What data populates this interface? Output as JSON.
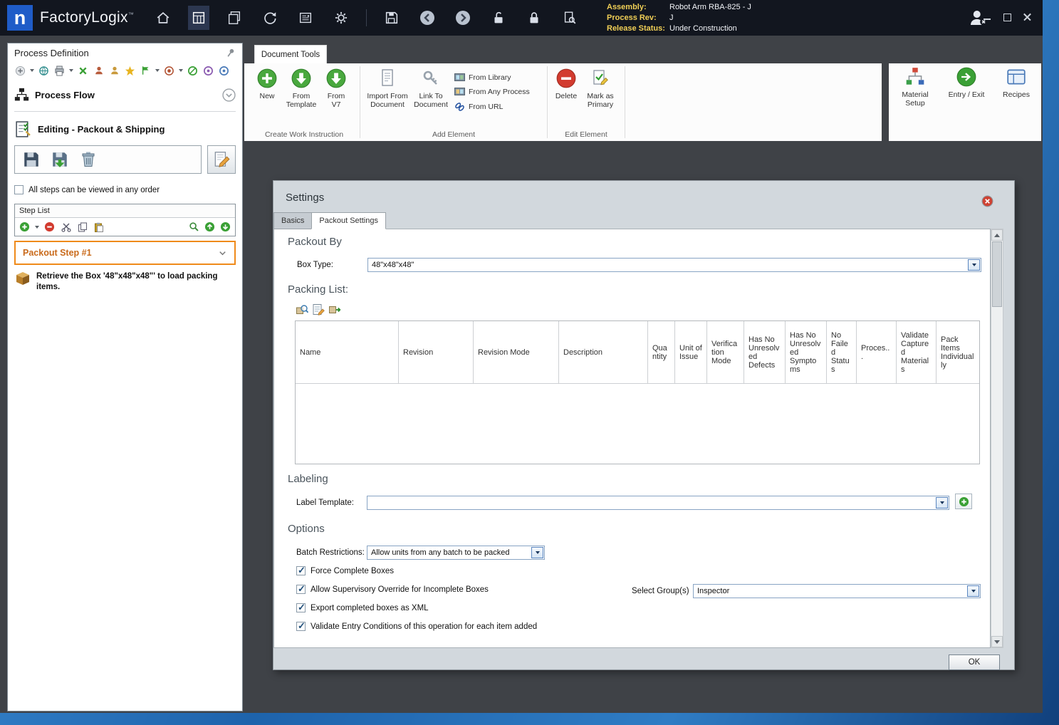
{
  "colors": {
    "titlebar_bg": "#12161F",
    "logo_blue": "#1F5CC8",
    "workspace_bg": "#3F4247",
    "dialog_bg": "#D2D8DD",
    "accent_orange": "#EF8A1A",
    "selected_step_text": "#C96A1B",
    "info_label_yellow": "#F0CF56"
  },
  "titlebar": {
    "logo_letter": "n",
    "app_name": "FactoryLogix",
    "trademark": "™",
    "info": {
      "assembly_label": "Assembly:",
      "assembly_value": "Robot Arm RBA-825 - J",
      "process_rev_label": "Process Rev:",
      "process_rev_value": "J",
      "release_status_label": "Release Status:",
      "release_status_value": "Under Construction"
    }
  },
  "left_panel": {
    "title": "Process Definition",
    "process_flow_label": "Process Flow",
    "editing_header": "Editing - Packout & Shipping",
    "order_checkbox_label": "All steps can be viewed in any order",
    "order_checkbox_checked": false,
    "step_list_title": "Step List",
    "selected_step_title": "Packout Step #1",
    "step_instruction": "Retrieve the Box '48\"x48\"x48\"' to load packing items."
  },
  "ribbon": {
    "tab_label": "Document Tools",
    "group_create": "Create Work Instruction",
    "group_add": "Add Element",
    "group_edit": "Edit Element",
    "new_label": "New",
    "from_template_label": "From Template",
    "from_v7_label": "From V7",
    "import_from_document_label": "Import From Document",
    "link_to_document_label": "Link To Document",
    "from_library_label": "From Library",
    "from_any_process_label": "From Any Process",
    "from_url_label": "From URL",
    "delete_label": "Delete",
    "mark_as_primary_label": "Mark as Primary",
    "material_setup_label": "Material Setup",
    "entry_exit_label": "Entry / Exit",
    "recipes_label": "Recipes"
  },
  "dialog": {
    "title": "Settings",
    "tab_basics": "Basics",
    "tab_packout": "Packout Settings",
    "heading_packout_by": "Packout By",
    "heading_packing_list": "Packing List:",
    "heading_labeling": "Labeling",
    "heading_options": "Options",
    "box_type_label": "Box Type:",
    "box_type_value": "48\"x48\"x48\"",
    "label_template_label": "Label Template:",
    "label_template_value": "",
    "batch_restrictions_label": "Batch Restrictions:",
    "batch_restrictions_value": "Allow units from any batch to be packed",
    "select_groups_label": "Select Group(s)",
    "select_groups_value": "Inspector",
    "ok_label": "OK",
    "grid_columns": [
      "Name",
      "Revision",
      "Revision Mode",
      "Description",
      "Quantity",
      "Unit of Issue",
      "Verification Mode",
      "Has No Unresolved Defects",
      "Has No Unresolved Symptoms",
      "No Failed Status",
      "Proces...",
      "Validate Captured Materials",
      "Pack Items Individually"
    ],
    "checkboxes": [
      {
        "label": "Force Complete Boxes",
        "checked": true
      },
      {
        "label": "Allow Supervisory Override for Incomplete Boxes",
        "checked": true
      },
      {
        "label": "Export completed boxes as XML",
        "checked": true
      },
      {
        "label": "Validate Entry Conditions of this operation for each item added",
        "checked": true
      }
    ]
  }
}
